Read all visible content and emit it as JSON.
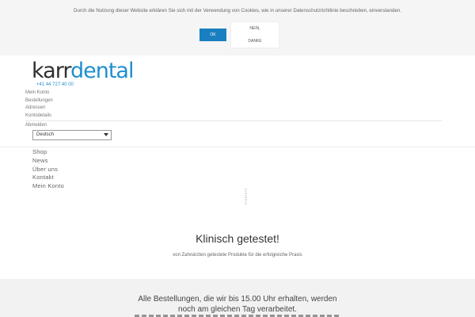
{
  "cookie": {
    "message": "Durch die Nutzung dieser Website erklären Sie sich mit der Verwendung von Cookies, wie in unserer Datenschutzrichtlinie beschrieben, einverstanden.",
    "ok_label": "OK",
    "nein_label": "NEIN,",
    "danke_label": "DANKE"
  },
  "header": {
    "logo_part1": "karr",
    "logo_part2": "dental",
    "phone": "+41 44 727 40 00",
    "account_links": [
      "Mein Konto",
      "Bestellungen",
      "Adressen",
      "Kontodetails"
    ],
    "logout": "Abmelden",
    "language_selected": "Deutsch"
  },
  "nav": {
    "items": [
      "Shop",
      "News",
      "Über uns",
      "Kontakt",
      "Mein Konto"
    ]
  },
  "hero": {
    "headline": "Klinisch getestet!",
    "subline": "von Zahnärzten getestete Produkte für die erfolgreiche Praxis"
  },
  "info": {
    "line1": "Alle Bestellungen, die wir bis 15.00 Uhr erhalten, werden",
    "line2": "noch am gleichen Tag verarbeitet."
  },
  "colors": {
    "accent": "#1e8fcf",
    "ok_button": "#1a7fc1"
  }
}
